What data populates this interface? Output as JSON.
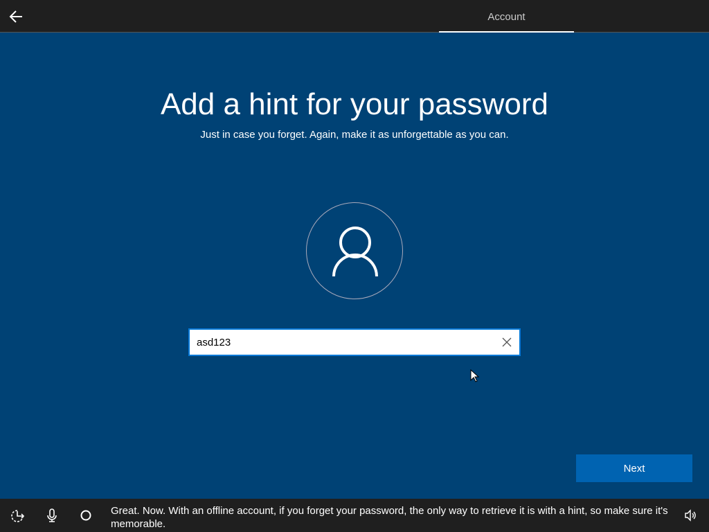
{
  "header": {
    "tab_label": "Account",
    "back_icon": "arrow-left-icon"
  },
  "main": {
    "title": "Add a hint for your password",
    "subtitle": "Just in case you forget. Again, make it as unforgettable as you can.",
    "hint_input": {
      "value": "asd123",
      "placeholder": ""
    },
    "next_label": "Next"
  },
  "footer": {
    "narration": "Great. Now. With an offline account, if you forget your password, the only way to retrieve it is with a hint, so make sure it's memorable."
  },
  "colors": {
    "background": "#004275",
    "accent": "#0078d7",
    "button": "#0063b1",
    "bar": "#1f1f1f"
  }
}
